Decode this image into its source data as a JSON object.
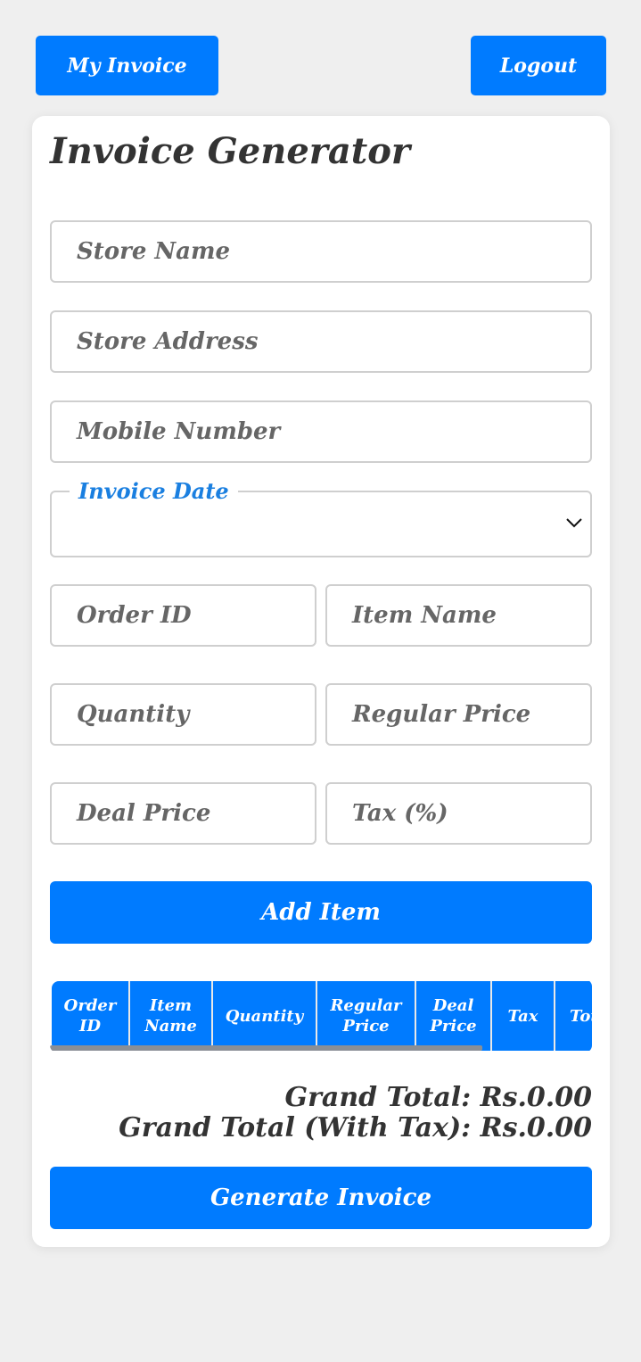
{
  "header": {
    "my_invoice_label": "My Invoice",
    "logout_label": "Logout"
  },
  "form": {
    "title": "Invoice Generator",
    "store_name_placeholder": "Store Name",
    "store_address_placeholder": "Store Address",
    "mobile_number_placeholder": "Mobile Number",
    "invoice_date_label": "Invoice Date",
    "invoice_date_value": "",
    "order_id_placeholder": "Order ID",
    "item_name_placeholder": "Item Name",
    "quantity_placeholder": "Quantity",
    "regular_price_placeholder": "Regular Price",
    "deal_price_placeholder": "Deal Price",
    "tax_placeholder": "Tax (%)",
    "add_item_label": "Add Item"
  },
  "table": {
    "columns": [
      "Order\nID",
      "Item\nName",
      "Quantity",
      "Regular\nPrice",
      "Deal\nPrice",
      "Tax",
      "Total"
    ],
    "rows": []
  },
  "totals": {
    "grand_total": "Grand Total: Rs.0.00",
    "grand_total_with_tax": "Grand Total (With Tax): Rs.0.00"
  },
  "actions": {
    "generate_label": "Generate Invoice"
  },
  "colors": {
    "accent": "#007bff",
    "background": "#efefef"
  },
  "icons": {
    "date_dropdown": "chevron-down-icon"
  }
}
